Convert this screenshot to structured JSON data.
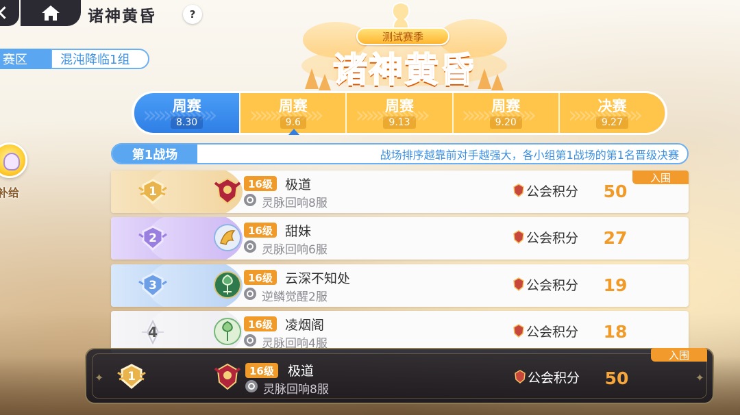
{
  "header": {
    "title": "诸神黄昏",
    "help_label": "?"
  },
  "region": {
    "label": "赛区",
    "value": "混沌降临1组"
  },
  "side": {
    "label": "补给"
  },
  "season": {
    "banner": "测试赛季",
    "title": "诸神黄昏"
  },
  "tabs": [
    {
      "name": "周赛",
      "date": "8.30",
      "active": true
    },
    {
      "name": "周赛",
      "date": "9.6"
    },
    {
      "name": "周赛",
      "date": "9.13"
    },
    {
      "name": "周赛",
      "date": "9.20"
    },
    {
      "name": "决赛",
      "date": "9.27"
    }
  ],
  "battlefield": {
    "tag": "第1战场",
    "description": "战场排序越靠前对手越强大，各小组第1战场的第1名晋级决赛"
  },
  "ranking": [
    {
      "rank": "1",
      "level": "16级",
      "guild": "极道",
      "server": "灵脉回响8服",
      "score_label": "公会积分",
      "score": "50",
      "qualified": "入围"
    },
    {
      "rank": "2",
      "level": "16级",
      "guild": "甜妹",
      "server": "灵脉回响6服",
      "score_label": "公会积分",
      "score": "27"
    },
    {
      "rank": "3",
      "level": "16级",
      "guild": "云深不知处",
      "server": "逆鳞觉醒2服",
      "score_label": "公会积分",
      "score": "19"
    },
    {
      "rank": "4",
      "level": "16级",
      "guild": "凌烟阁",
      "server": "灵脉回响4服",
      "score_label": "公会积分",
      "score": "18"
    }
  ],
  "my_guild": {
    "rank": "1",
    "level": "16级",
    "guild": "极道",
    "server": "灵脉回响8服",
    "score_label": "公会积分",
    "score": "50",
    "qualified": "入围"
  },
  "colors": {
    "accent_blue": "#5aa6f0",
    "tab_orange": "#ffc44a",
    "score_orange": "#f09a2a",
    "gold": "#e9b44c",
    "purple": "#9b7fe0",
    "blue_rank": "#6d9fe6"
  },
  "icons": [
    "home-icon",
    "help-icon",
    "server-globe-icon",
    "guild-score-icon",
    "guild-emblem-icon",
    "rank-medal-icon"
  ]
}
